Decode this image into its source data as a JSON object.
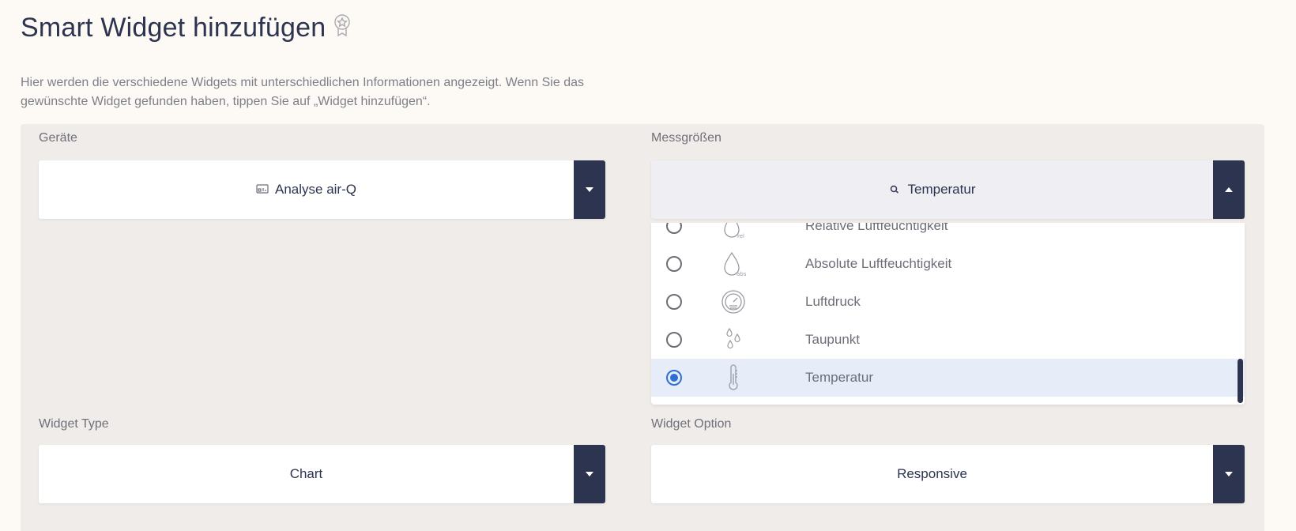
{
  "page": {
    "title": "Smart Widget hinzufügen",
    "intro": "Hier werden die verschiedene Widgets mit unterschiedlichen Informationen angezeigt. Wenn Sie das gewünschte Widget gefunden haben, tippen Sie auf „Widget hinzufügen“."
  },
  "devices": {
    "label": "Geräte",
    "value": "Analyse air-Q",
    "icon": "device-icon"
  },
  "measurements": {
    "label": "Messgrößen",
    "value": "Temperatur",
    "icon": "search-icon",
    "options": [
      {
        "label": "Relative Luftfeuchtigkeit",
        "icon": "humidity-relative-icon",
        "selected": false
      },
      {
        "label": "Absolute Luftfeuchtigkeit",
        "icon": "humidity-absolute-icon",
        "selected": false
      },
      {
        "label": "Luftdruck",
        "icon": "pressure-gauge-icon",
        "selected": false
      },
      {
        "label": "Taupunkt",
        "icon": "dew-point-icon",
        "selected": false
      },
      {
        "label": "Temperatur",
        "icon": "thermometer-icon",
        "selected": true
      }
    ]
  },
  "widget_type": {
    "label": "Widget Type",
    "value": "Chart"
  },
  "widget_option": {
    "label": "Widget Option",
    "value": "Responsive"
  },
  "colors": {
    "dark": "#2d3450",
    "accent": "#2f6fd1",
    "selected_bg": "#e6edf8",
    "panel_bg": "#f0ece9",
    "page_bg": "#fdf9f5"
  }
}
